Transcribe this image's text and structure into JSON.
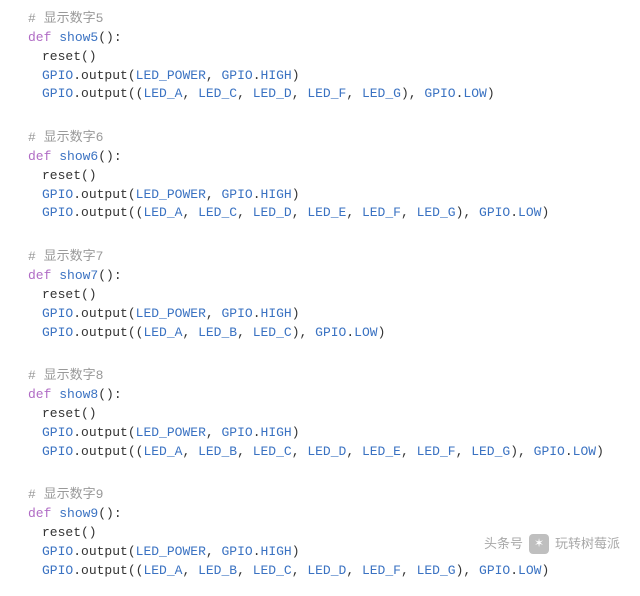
{
  "syntax": {
    "keyword_def": "def",
    "paren_open": "(",
    "paren_close": ")",
    "colon": ":",
    "comma": ", ",
    "dot": ".",
    "tuple_open": "((",
    "tuple_close": ")",
    "call_close": ")"
  },
  "idents": {
    "GPIO": "GPIO",
    "output": "output",
    "reset_call": "reset()",
    "HIGH": "HIGH",
    "LOW": "LOW",
    "LED_POWER": "LED_POWER",
    "LED_A": "LED_A",
    "LED_B": "LED_B",
    "LED_C": "LED_C",
    "LED_D": "LED_D",
    "LED_E": "LED_E",
    "LED_F": "LED_F",
    "LED_G": "LED_G"
  },
  "functions": [
    {
      "comment": "# 显示数字5",
      "name": "show5",
      "leds": [
        "LED_A",
        "LED_C",
        "LED_D",
        "LED_F",
        "LED_G"
      ]
    },
    {
      "comment": "# 显示数字6",
      "name": "show6",
      "leds": [
        "LED_A",
        "LED_C",
        "LED_D",
        "LED_E",
        "LED_F",
        "LED_G"
      ]
    },
    {
      "comment": "# 显示数字7",
      "name": "show7",
      "leds": [
        "LED_A",
        "LED_B",
        "LED_C"
      ]
    },
    {
      "comment": "# 显示数字8",
      "name": "show8",
      "leds": [
        "LED_A",
        "LED_B",
        "LED_C",
        "LED_D",
        "LED_E",
        "LED_F",
        "LED_G"
      ]
    },
    {
      "comment": "# 显示数字9",
      "name": "show9",
      "leds": [
        "LED_A",
        "LED_B",
        "LED_C",
        "LED_D",
        "LED_F",
        "LED_G"
      ]
    }
  ],
  "watermark": {
    "text1": "头条号",
    "text2": "玩转树莓派"
  }
}
